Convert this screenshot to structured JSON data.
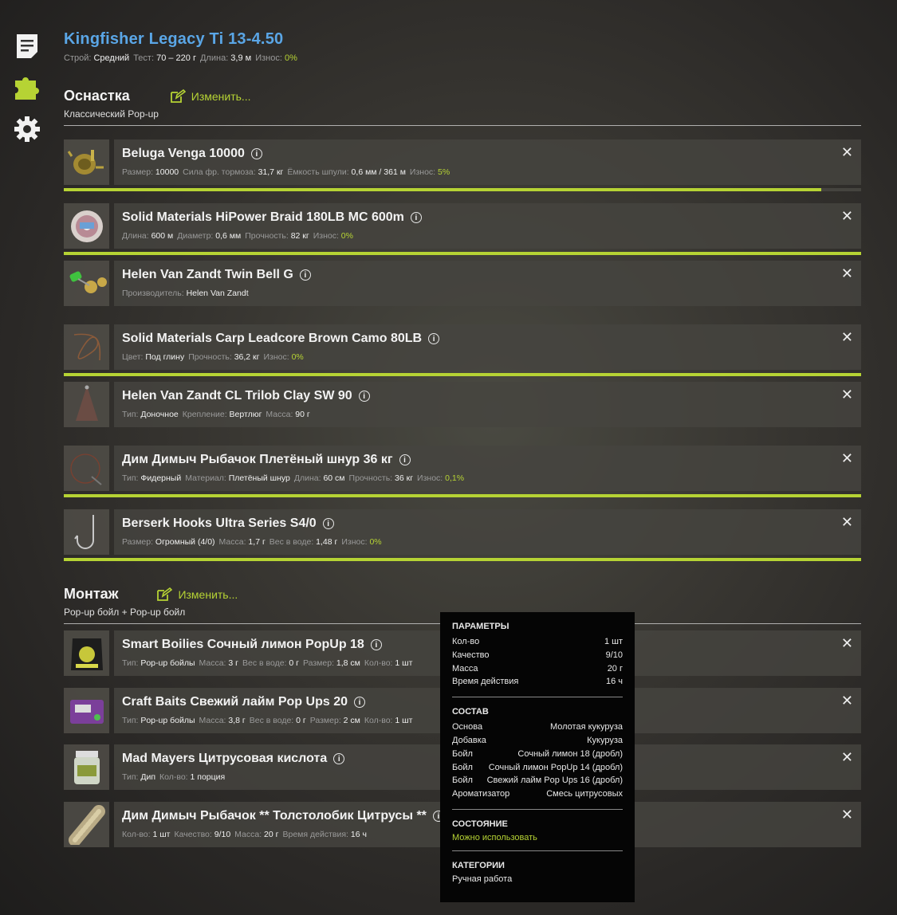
{
  "sidebar": {
    "icons": [
      "document-icon",
      "puzzle-icon",
      "gear-icon"
    ],
    "accent": "#b6d334"
  },
  "rod": {
    "title": "Kingfisher Legacy Ti 13-4.50",
    "props": [
      {
        "k": "Строй:",
        "v": "Средний"
      },
      {
        "k": "Тест:",
        "v": "70 – 220 г"
      },
      {
        "k": "Длина:",
        "v": "3,9 м"
      },
      {
        "k": "Износ:",
        "v": "0%",
        "green": true
      }
    ]
  },
  "rig": {
    "title": "Оснастка",
    "edit_label": "Изменить...",
    "subtitle": "Классический Pop-up",
    "items": [
      {
        "name": "Beluga Venga 10000",
        "icon": "reel-icon",
        "bar": 0.95,
        "props": [
          {
            "k": "Размер:",
            "v": "10000"
          },
          {
            "k": "Сила фр. тормоза:",
            "v": "31,7 кг"
          },
          {
            "k": "Ёмкость шпули:",
            "v": "0,6 мм / 361 м"
          },
          {
            "k": "Износ:",
            "v": "5%",
            "green": true
          }
        ]
      },
      {
        "name": "Solid Materials HiPower Braid 180LB MC 600m",
        "icon": "line-spool-icon",
        "bar": 1,
        "props": [
          {
            "k": "Длина:",
            "v": "600 м"
          },
          {
            "k": "Диаметр:",
            "v": "0,6 мм"
          },
          {
            "k": "Прочность:",
            "v": "82 кг"
          },
          {
            "k": "Износ:",
            "v": "0%",
            "green": true
          }
        ]
      },
      {
        "name": "Helen Van Zandt Twin Bell G",
        "icon": "bells-icon",
        "bar": null,
        "props": [
          {
            "k": "Производитель:",
            "v": "Helen Van Zandt"
          }
        ]
      },
      {
        "name": "Solid Materials Carp Leadcore Brown Camo 80LB",
        "icon": "leadcore-icon",
        "bar": 1,
        "props": [
          {
            "k": "Цвет:",
            "v": "Под глину"
          },
          {
            "k": "Прочность:",
            "v": "36,2 кг"
          },
          {
            "k": "Износ:",
            "v": "0%",
            "green": true
          }
        ]
      },
      {
        "name": "Helen Van Zandt CL Trilob Clay SW 90",
        "icon": "sinker-icon",
        "bar": null,
        "props": [
          {
            "k": "Тип:",
            "v": "Доночное"
          },
          {
            "k": "Крепление:",
            "v": "Вертлюг"
          },
          {
            "k": "Масса:",
            "v": "90 г"
          }
        ]
      },
      {
        "name": "Дим Димыч Рыбачок Плетёный шнур 36 кг",
        "icon": "braid-leader-icon",
        "bar": 1,
        "props": [
          {
            "k": "Тип:",
            "v": "Фидерный"
          },
          {
            "k": "Материал:",
            "v": "Плетёный шнур"
          },
          {
            "k": "Длина:",
            "v": "60 см"
          },
          {
            "k": "Прочность:",
            "v": "36 кг"
          },
          {
            "k": "Износ:",
            "v": "0,1%",
            "green": true
          }
        ]
      },
      {
        "name": "Berserk Hooks Ultra Series S4/0",
        "icon": "hook-icon",
        "bar": 1,
        "props": [
          {
            "k": "Размер:",
            "v": "Огромный (4/0)"
          },
          {
            "k": "Масса:",
            "v": "1,7 г"
          },
          {
            "k": "Вес в воде:",
            "v": "1,48 г"
          },
          {
            "k": "Износ:",
            "v": "0%",
            "green": true
          }
        ]
      }
    ]
  },
  "mount": {
    "title": "Монтаж",
    "edit_label": "Изменить...",
    "subtitle": "Pop-up бойл  +  Pop-up бойл",
    "items": [
      {
        "name": "Smart Boilies Сочный лимон PopUp 18",
        "icon": "boilie-bag-icon",
        "props": [
          {
            "k": "Тип:",
            "v": "Pop-up бойлы"
          },
          {
            "k": "Масса:",
            "v": "3 г"
          },
          {
            "k": "Вес в воде:",
            "v": "0 г"
          },
          {
            "k": "Размер:",
            "v": "1,8 см"
          },
          {
            "k": "Кол-во:",
            "v": "1 шт"
          }
        ]
      },
      {
        "name": "Craft Baits Свежий лайм Pop Ups 20",
        "icon": "boilie-box-icon",
        "props": [
          {
            "k": "Тип:",
            "v": "Pop-up бойлы"
          },
          {
            "k": "Масса:",
            "v": "3,8 г"
          },
          {
            "k": "Вес в воде:",
            "v": "0 г"
          },
          {
            "k": "Размер:",
            "v": "2 см"
          },
          {
            "k": "Кол-во:",
            "v": "1 шт"
          }
        ]
      },
      {
        "name": "Mad Mayers Цитрусовая кислота",
        "icon": "dip-jar-icon",
        "props": [
          {
            "k": "Тип:",
            "v": "Дип"
          },
          {
            "k": "Кол-во:",
            "v": "1 порция"
          }
        ]
      },
      {
        "name": "Дим Димыч Рыбачок ** Толстолобик Цитрусы **",
        "icon": "pva-mesh-icon",
        "props": [
          {
            "k": "Кол-во:",
            "v": "1 шт"
          },
          {
            "k": "Качество:",
            "v": "9/10"
          },
          {
            "k": "Масса:",
            "v": "20 г"
          },
          {
            "k": "Время действия:",
            "v": "16 ч"
          }
        ]
      }
    ]
  },
  "tooltip": {
    "params_title": "ПАРАМЕТРЫ",
    "params": [
      {
        "k": "Кол-во",
        "v": "1 шт"
      },
      {
        "k": "Качество",
        "v": "9/10"
      },
      {
        "k": "Масса",
        "v": "20 г"
      },
      {
        "k": "Время действия",
        "v": "16 ч"
      }
    ],
    "composition_title": "СОСТАВ",
    "composition": [
      {
        "k": "Основа",
        "v": "Молотая кукуруза"
      },
      {
        "k": "Добавка",
        "v": "Кукуруза"
      },
      {
        "k": "Бойл",
        "v": "Сочный лимон 18 (дробл)"
      },
      {
        "k": "Бойл",
        "v": "Сочный лимон PopUp 14 (дробл)"
      },
      {
        "k": "Бойл",
        "v": "Свежий лайм Pop Ups 16 (дробл)"
      },
      {
        "k": "Ароматизатор",
        "v": "Смесь цитрусовых"
      }
    ],
    "state_title": "СОСТОЯНИЕ",
    "state": "Можно использовать",
    "categories_title": "КАТЕГОРИИ",
    "category": "Ручная работа"
  }
}
